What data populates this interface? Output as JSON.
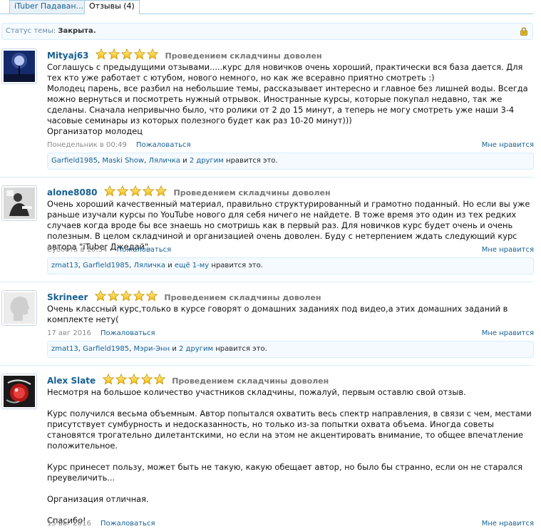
{
  "tabs": [
    {
      "label": "iTuber Падаван..."
    },
    {
      "label": "Отзывы (4)"
    }
  ],
  "status": {
    "label": "Статус темы:",
    "value": "Закрыта.",
    "icon": "lock-icon"
  },
  "rating_title": "Проведением складчины доволен",
  "rating_stars": 5,
  "actions": {
    "report": "Пожаловаться",
    "like": "Мне нравится"
  },
  "reviews": [
    {
      "author": "Mityaj63",
      "text": "Соглашусь с предыдущими отзывами.....курс для новичков очень хороший, практически вся база дается. Для тех кто уже работает с ютубом, нового немного, но как же всеравно приятно смотреть :)\nМолодец парень, все разбил на небольшие темы, рассказывает интересно и главное без лишней воды. Всегда можно вернуться и посмотреть нужный отрывок. Иностранные курсы, которые покупал недавно, так же сделаны. Сначала непривычно было, что ролики от 2 до 15 минут, а теперь не могу смотреть уже наши 3-4 часовые семинары из которых полезного будет как раз 10-20 минут)))\nОрганизатор молодец",
      "date": "Понедельник в 00:49",
      "likes": {
        "users": [
          "Garfield1985",
          "Maski Show",
          "Ляличка"
        ],
        "and": "и",
        "more": "2 другим",
        "suffix": "нравится это."
      }
    },
    {
      "author": "alone8080",
      "text": "Очень хороший качественный материал, правильно структурированный и грамотно поданный. Но если вы уже раньше изучали курсы по YouTube нового для себя ничего не найдете. В тоже время это один из тех редких случаев когда вроде бы все знаешь но смотришь как в первый раз. Для новичков курс будет очень и очень полезным. В целом складчиной и организацией очень доволен. Буду с нетерпением ждать следующий курс автора \"iTuber Джедай\".",
      "date": "Суббота в 10:34",
      "likes": {
        "users": [
          "zmat13",
          "Garfield1985",
          "Ляличка"
        ],
        "and": "и",
        "more": "ещё 1-му",
        "suffix": "нравится это."
      }
    },
    {
      "author": "Skrineer",
      "text": "Очень классный курс,только в курсе говорят о домашних заданиях под видео,а этих домашних заданий в комплекте нету(",
      "date": "17 авг 2016",
      "likes": {
        "users": [
          "zmat13",
          "Garfield1985",
          "Мэри-Энн"
        ],
        "and": "и",
        "more": "2 другим",
        "suffix": "нравится это."
      }
    },
    {
      "author": "Alex Slate",
      "text": "Несмотря на большое количество участников складчины, пожалуй, первым оставлю свой отзыв.\n\nКурс получился весьма объемным. Автор попытался охватить весь спектр направления, в связи с чем, местами присутствует сумбурность и недосказанность, но только из-за попытки охвата объема. Иногда советы становятся трогательно дилетантскими, но если на этом не акцентировать внимание, то общее впечатление положительное.\n\nКурс принесет пользу, может быть не такую, какую обещает автор, но было бы странно, если он не старался преувеличить...\n\nОрганизация отличная.\n\nСпасибо!",
      "date": "15 авг 2016"
    }
  ]
}
